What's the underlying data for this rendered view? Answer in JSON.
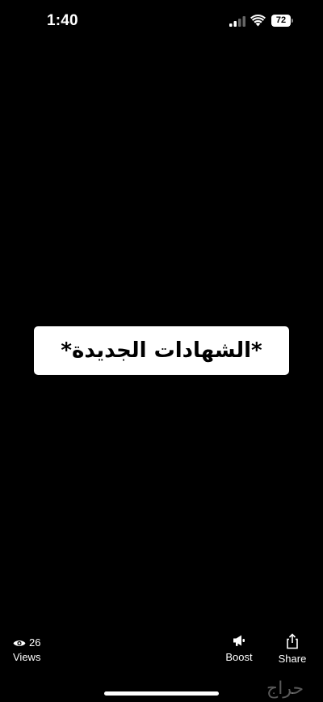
{
  "status_bar": {
    "time": "1:40",
    "battery_level": "72"
  },
  "content": {
    "label": "*الشهادات الجديدة*"
  },
  "stats": {
    "views_count": "26",
    "views_label": "Views"
  },
  "actions": {
    "boost_label": "Boost",
    "share_label": "Share"
  },
  "watermark": {
    "text": "حراج"
  }
}
